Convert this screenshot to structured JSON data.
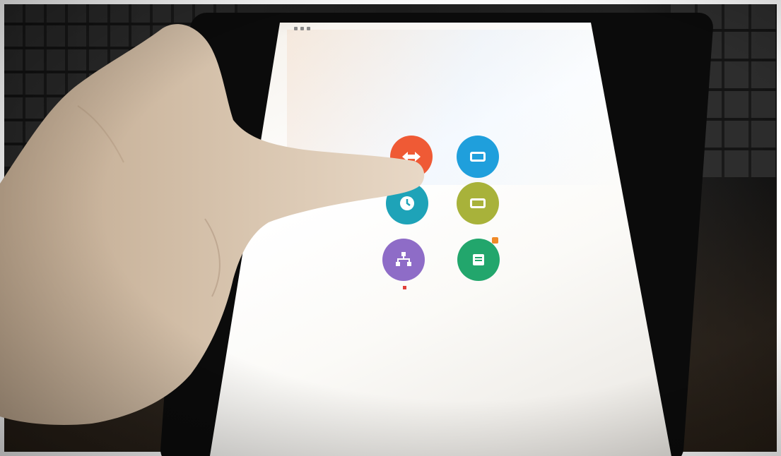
{
  "photo": {
    "description_colors": {
      "background_dark": "#1c1c1c",
      "screen_light": "#fbfaf7",
      "skin": "#d8c2a8"
    }
  },
  "tablet": {
    "apps": [
      {
        "id": "app-1",
        "icon": "arrows-icon",
        "color": "#ef5a35",
        "label": ""
      },
      {
        "id": "app-2",
        "icon": "screen-icon",
        "color": "#1f9fdc",
        "label": ""
      },
      {
        "id": "app-3",
        "icon": "clock-icon",
        "color": "#1ea3b8",
        "label": ""
      },
      {
        "id": "app-4",
        "icon": "window-icon",
        "color": "#a8b23a",
        "label": ""
      },
      {
        "id": "app-5",
        "icon": "network-icon",
        "color": "#8e6cc7",
        "label": ""
      },
      {
        "id": "app-6",
        "icon": "document-icon",
        "color": "#22a66c",
        "label": ""
      }
    ]
  }
}
